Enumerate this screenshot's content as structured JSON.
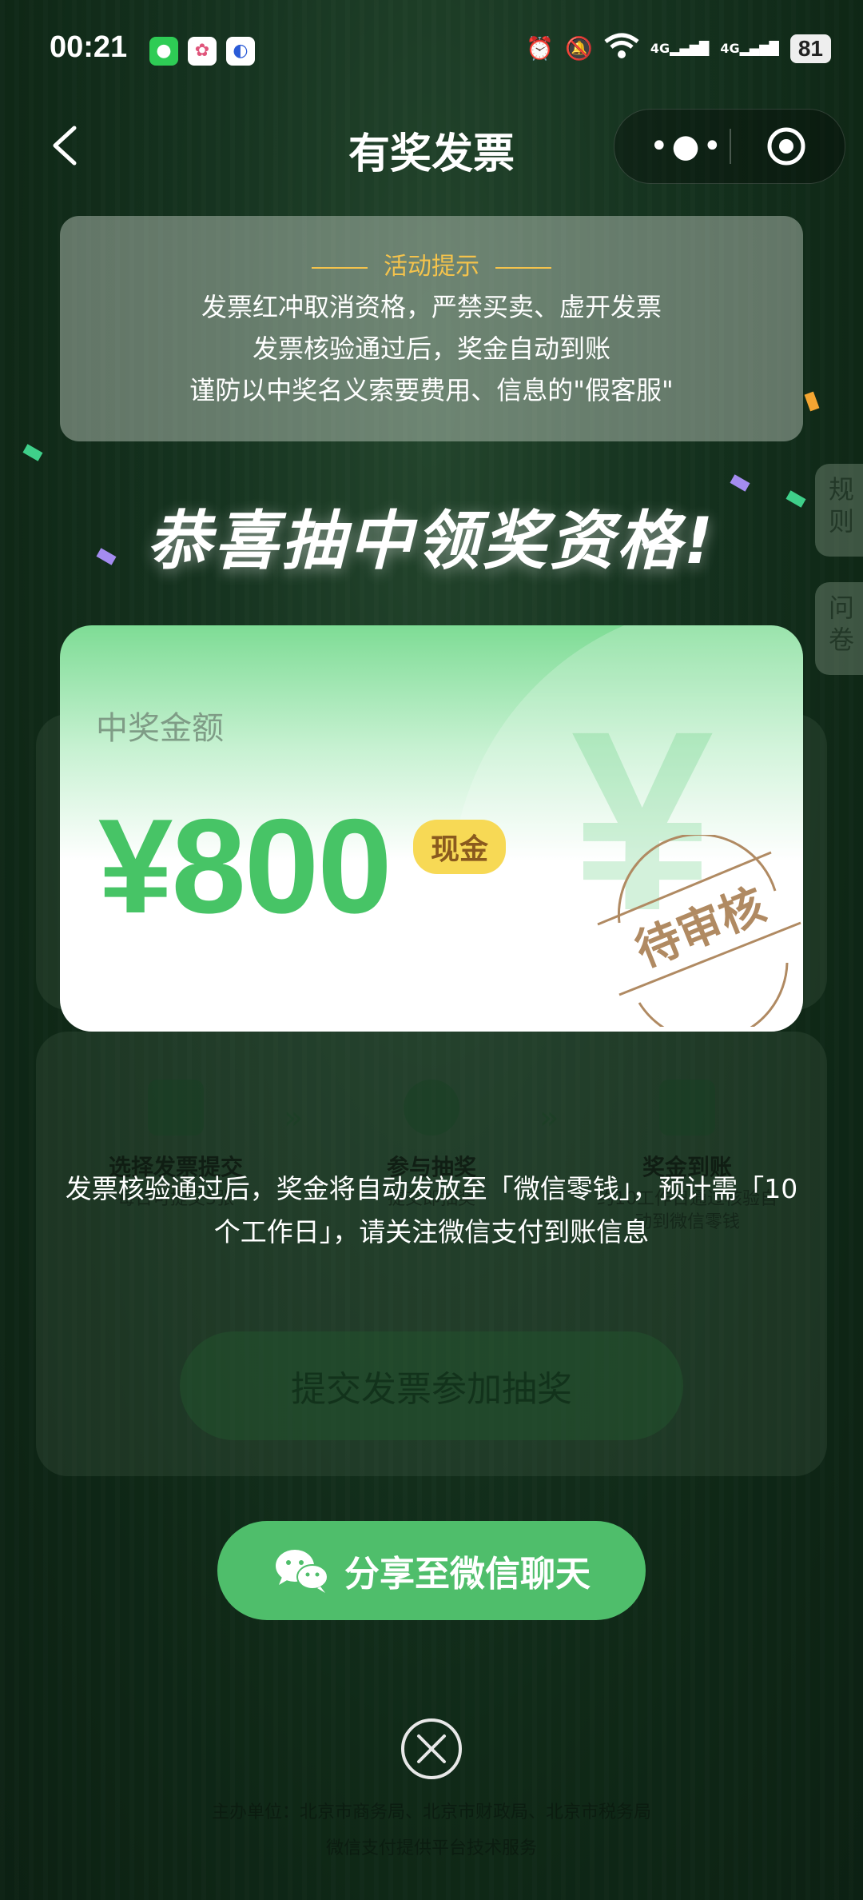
{
  "status_bar": {
    "time": "00:21",
    "battery": "81",
    "network_1": "4G",
    "network_2": "4G"
  },
  "nav": {
    "title": "有奖发票",
    "more_icon": "more-dots-icon",
    "close_icon": "target-circle-icon"
  },
  "notice": {
    "title": "活动提示",
    "lines": [
      "发票红冲取消资格，严禁买卖、虚开发票",
      "发票核验通过后，奖金自动到账",
      "谨防以中奖名义索要费用、信息的\"假客服\""
    ]
  },
  "side_tabs": {
    "rules": "规则",
    "survey": "问卷"
  },
  "congrats": "恭喜抽中领奖资格!",
  "prize": {
    "label": "中奖金额",
    "amount": "¥800",
    "badge": "现金",
    "watermark": "¥",
    "stamp": "待审核"
  },
  "info_text": "发票核验通过后，奖金将自动发放至「微信零钱」，预计需「10个工作日」，请关注微信支付到账信息",
  "share_button": "分享至微信聊天",
  "background_page": {
    "steps": [
      {
        "title": "选择发票提交",
        "desc": "每日可提交5张"
      },
      {
        "title": "参与抽奖",
        "desc": "提交即抽奖"
      },
      {
        "title": "奖金到账",
        "desc": "约10工作日通过核验自动到微信零钱"
      }
    ],
    "submit_button": "提交发票参加抽奖",
    "footer_line1": "主办单位：北京市商务局、北京市财政局、北京市税务局",
    "footer_line2": "微信支付提供平台技术服务"
  },
  "colors": {
    "accent_green": "#4fbe6b",
    "amount_green": "#47c466",
    "notice_gold": "#f4c34c",
    "badge_yellow": "#f7d955"
  }
}
